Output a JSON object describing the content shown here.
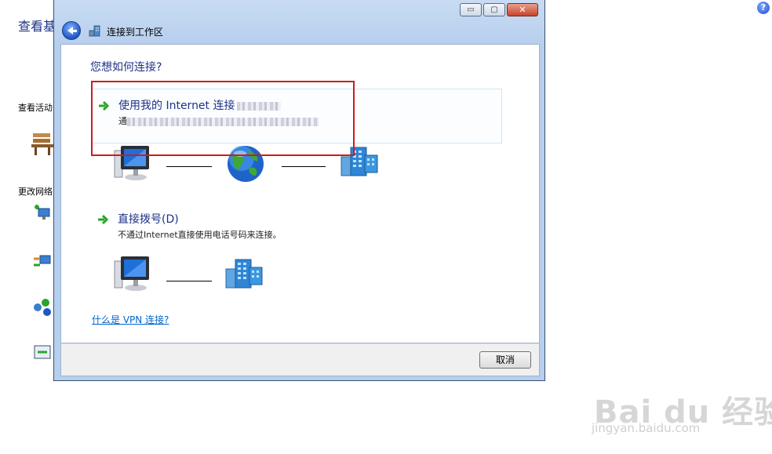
{
  "background_page": {
    "title": "查看基",
    "section_activity": "查看活动",
    "section_change": "更改网络",
    "help_glyph": "?"
  },
  "window": {
    "title": "连接到工作区",
    "caption": {
      "minimize": "▭",
      "maximize": "▢",
      "close": "✕"
    }
  },
  "dialog": {
    "question": "您想如何连接?",
    "option_internet": {
      "title": "使用我的 Internet 连接",
      "desc_prefix": "通"
    },
    "option_dial": {
      "title": "直接拨号(D)",
      "desc": "不通过Internet直接使用电话号码来连接。"
    },
    "vpn_link": "什么是 VPN 连接?",
    "cancel": "取消"
  },
  "watermark": {
    "brand": "Bai du 经验",
    "url": "jingyan.baidu.com"
  },
  "colors": {
    "heading_blue": "#1e3287",
    "link_blue": "#0066cc",
    "highlight_red": "#d21a1a",
    "arrow_green": "#2aa52a"
  }
}
